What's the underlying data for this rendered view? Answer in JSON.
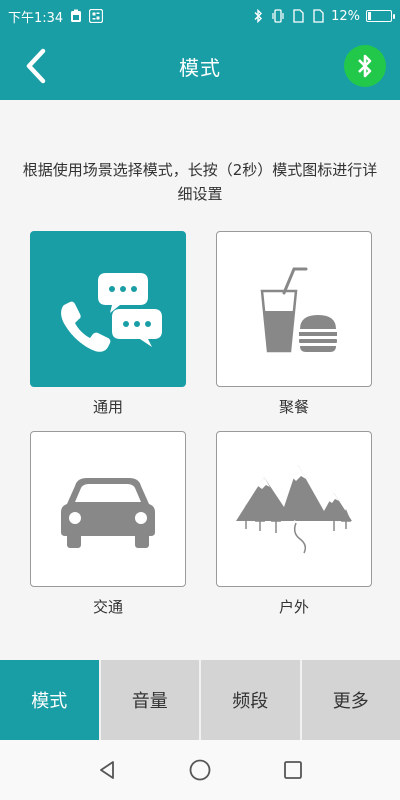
{
  "status_bar": {
    "time": "下午1:34",
    "battery_percent": "12%",
    "battery_level": 0.12,
    "left_icons": [
      "battery-saver-icon",
      "scan-icon"
    ],
    "right_icons": [
      "bluetooth-icon",
      "vibrate-icon",
      "sim1-no-signal-icon",
      "sim2-no-signal-icon"
    ]
  },
  "app_bar": {
    "title": "模式",
    "back_icon": "chevron-left-icon",
    "bluetooth_icon": "bluetooth-icon",
    "bluetooth_color": "#22c84a"
  },
  "main": {
    "instructions": "根据使用场景选择模式，长按（2秒）模式图标进行详细设置",
    "modes": [
      {
        "label": "通用",
        "icon": "phone-chat-icon",
        "active": true
      },
      {
        "label": "聚餐",
        "icon": "drink-burger-icon",
        "active": false
      },
      {
        "label": "交通",
        "icon": "car-icon",
        "active": false
      },
      {
        "label": "户外",
        "icon": "mountains-icon",
        "active": false
      }
    ]
  },
  "tabs": [
    {
      "label": "模式",
      "active": true
    },
    {
      "label": "音量",
      "active": false
    },
    {
      "label": "频段",
      "active": false
    },
    {
      "label": "更多",
      "active": false
    }
  ],
  "nav_bar": {
    "buttons": [
      "back-triangle-icon",
      "home-circle-icon",
      "recents-square-icon"
    ]
  },
  "colors": {
    "accent": "#1a9ea6",
    "tab_inactive": "#d4d4d4",
    "icon_gray": "#888888"
  }
}
